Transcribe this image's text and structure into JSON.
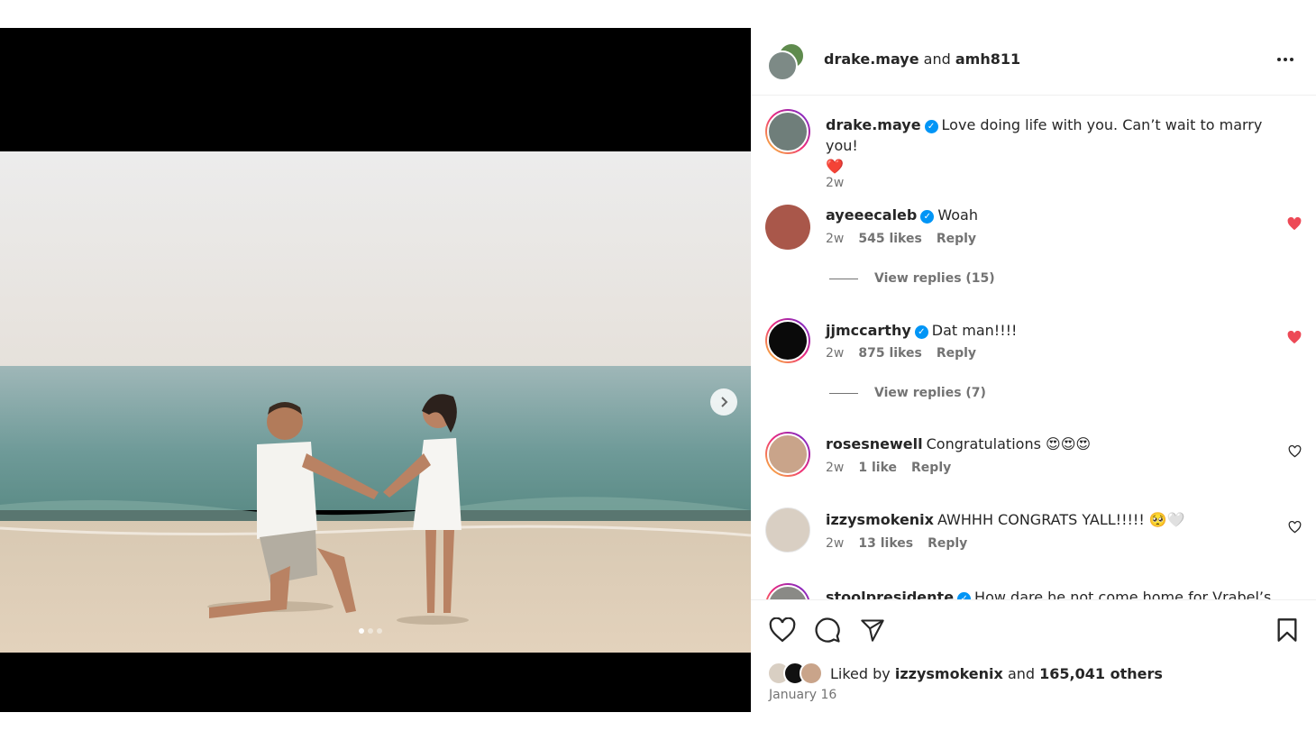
{
  "header": {
    "user1": "drake.maye",
    "conjunction": "and",
    "user2": "amh811",
    "more_icon": "more-horizontal-icon"
  },
  "caption": {
    "username": "drake.maye",
    "text": "Love doing life with you. Can’t wait to marry you!",
    "emoji": "❤️",
    "time": "2w"
  },
  "comments": [
    {
      "username": "ayeeecaleb",
      "verified": true,
      "text": "Woah",
      "time": "2w",
      "likes": "545 likes",
      "reply": "Reply",
      "view_replies": "View replies (15)",
      "liked": true
    },
    {
      "username": "jjmccarthy",
      "verified": true,
      "text": "Dat man!!!!",
      "time": "2w",
      "likes": "875 likes",
      "reply": "Reply",
      "view_replies": "View replies (7)",
      "liked": true
    },
    {
      "username": "rosesnewell",
      "verified": false,
      "text": "Congratulations",
      "emojis": "😍😍😍",
      "time": "2w",
      "likes": "1 like",
      "reply": "Reply",
      "liked": false
    },
    {
      "username": "izzysmokenix",
      "verified": false,
      "text": "AWHHH CONGRATS YALL!!!!!",
      "emojis": "🥺🤍",
      "time": "2w",
      "likes": "13 likes",
      "reply": "Reply",
      "liked": false
    },
    {
      "username": "stoolpresidente",
      "verified": true,
      "text": "How dare he not come home for Vrabel’s"
    }
  ],
  "actions": {
    "like_icon": "heart-outline-icon",
    "comment_icon": "comment-icon",
    "share_icon": "send-icon",
    "save_icon": "bookmark-icon"
  },
  "likes": {
    "prefix": "Liked by",
    "user": "izzysmokenix",
    "conjunction": "and",
    "others": "165,041 others"
  },
  "date": "January 16",
  "carousel": {
    "slide_count": 3,
    "active_slide": 1
  },
  "colors": {
    "liked_heart": "#ed4956",
    "verified": "#0095f6",
    "muted_text": "#737373"
  }
}
